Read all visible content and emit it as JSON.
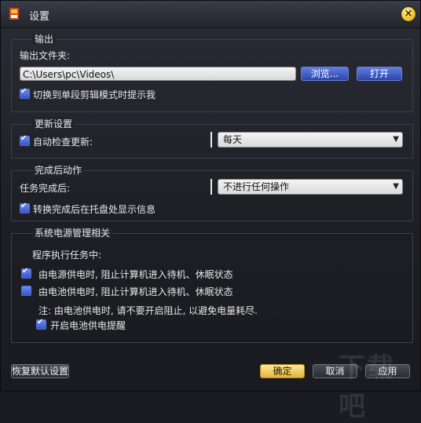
{
  "window": {
    "title": "设置"
  },
  "output": {
    "legend": "输出",
    "folder_label": "输出文件夹:",
    "folder_value": "C:\\Users\\pc\\Videos\\",
    "browse_label": "浏览...",
    "open_label": "打开",
    "prompt_label": "切换到单段剪辑模式时提示我",
    "prompt_checked": true
  },
  "update": {
    "legend": "更新设置",
    "auto_label": "自动检查更新:",
    "auto_checked": true,
    "frequency": "每天"
  },
  "after": {
    "legend": "完成后动作",
    "task_label": "任务完成后:",
    "task_action": "不进行任何操作",
    "tray_label": "转换完成后在托盘处显示信息",
    "tray_checked": true
  },
  "power": {
    "legend": "系统电源管理相关",
    "running_label": "程序执行任务中:",
    "ac_label": "由电源供电时, 阻止计算机进入待机、休眠状态",
    "ac_checked": true,
    "battery_label": "由电池供电时, 阻止计算机进入待机、休眠状态",
    "battery_checked": false,
    "note": "注: 由电池供电时, 请不要开启阻止, 以避免电量耗尽.",
    "reminder_label": "开启电池供电提醒",
    "reminder_checked": true
  },
  "footer": {
    "restore_label": "恢复默认设置",
    "ok_label": "确定",
    "cancel_label": "取消",
    "apply_label": "应用"
  },
  "colors": {
    "accent": "#3656c8",
    "primary_button": "#e3b53a"
  }
}
